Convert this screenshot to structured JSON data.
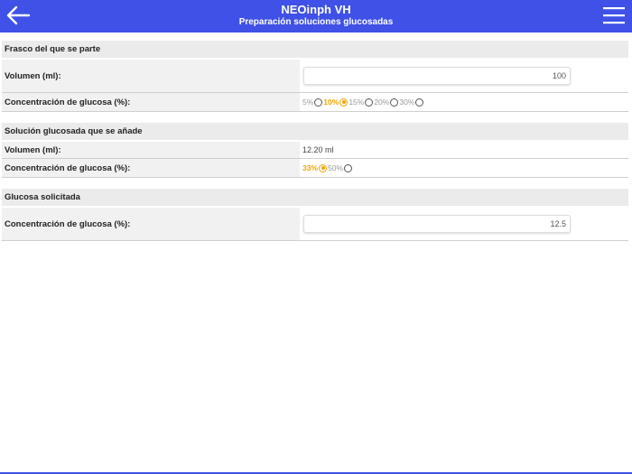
{
  "header": {
    "title": "NEOinph VH",
    "subtitle": "Preparación soluciones glucosadas",
    "back_icon": "arrow-left-icon",
    "menu_icon": "hamburger-menu-icon",
    "color": "#3f51e6"
  },
  "sections": {
    "frasco": {
      "title": "Frasco del que se parte",
      "volume_label": "Volumen (ml):",
      "volume_value": "100",
      "conc_label": "Concentración de glucosa (%):",
      "options": [
        "5%",
        "10%",
        "15%",
        "20%",
        "30%"
      ],
      "selected": "10%"
    },
    "solucion": {
      "title": "Solución glucosada que se añade",
      "volume_label": "Volumen (ml):",
      "volume_value": "12.20 ml",
      "conc_label": "Concentración de glucosa (%):",
      "options": [
        "33%",
        "50%"
      ],
      "selected": "33%"
    },
    "solicitada": {
      "title": "Glucosa solicitada",
      "conc_label": "Concentración de glucosa (%):",
      "conc_value": "12.5"
    }
  },
  "colors": {
    "accent": "#f0a500",
    "header": "#3f51e6"
  }
}
